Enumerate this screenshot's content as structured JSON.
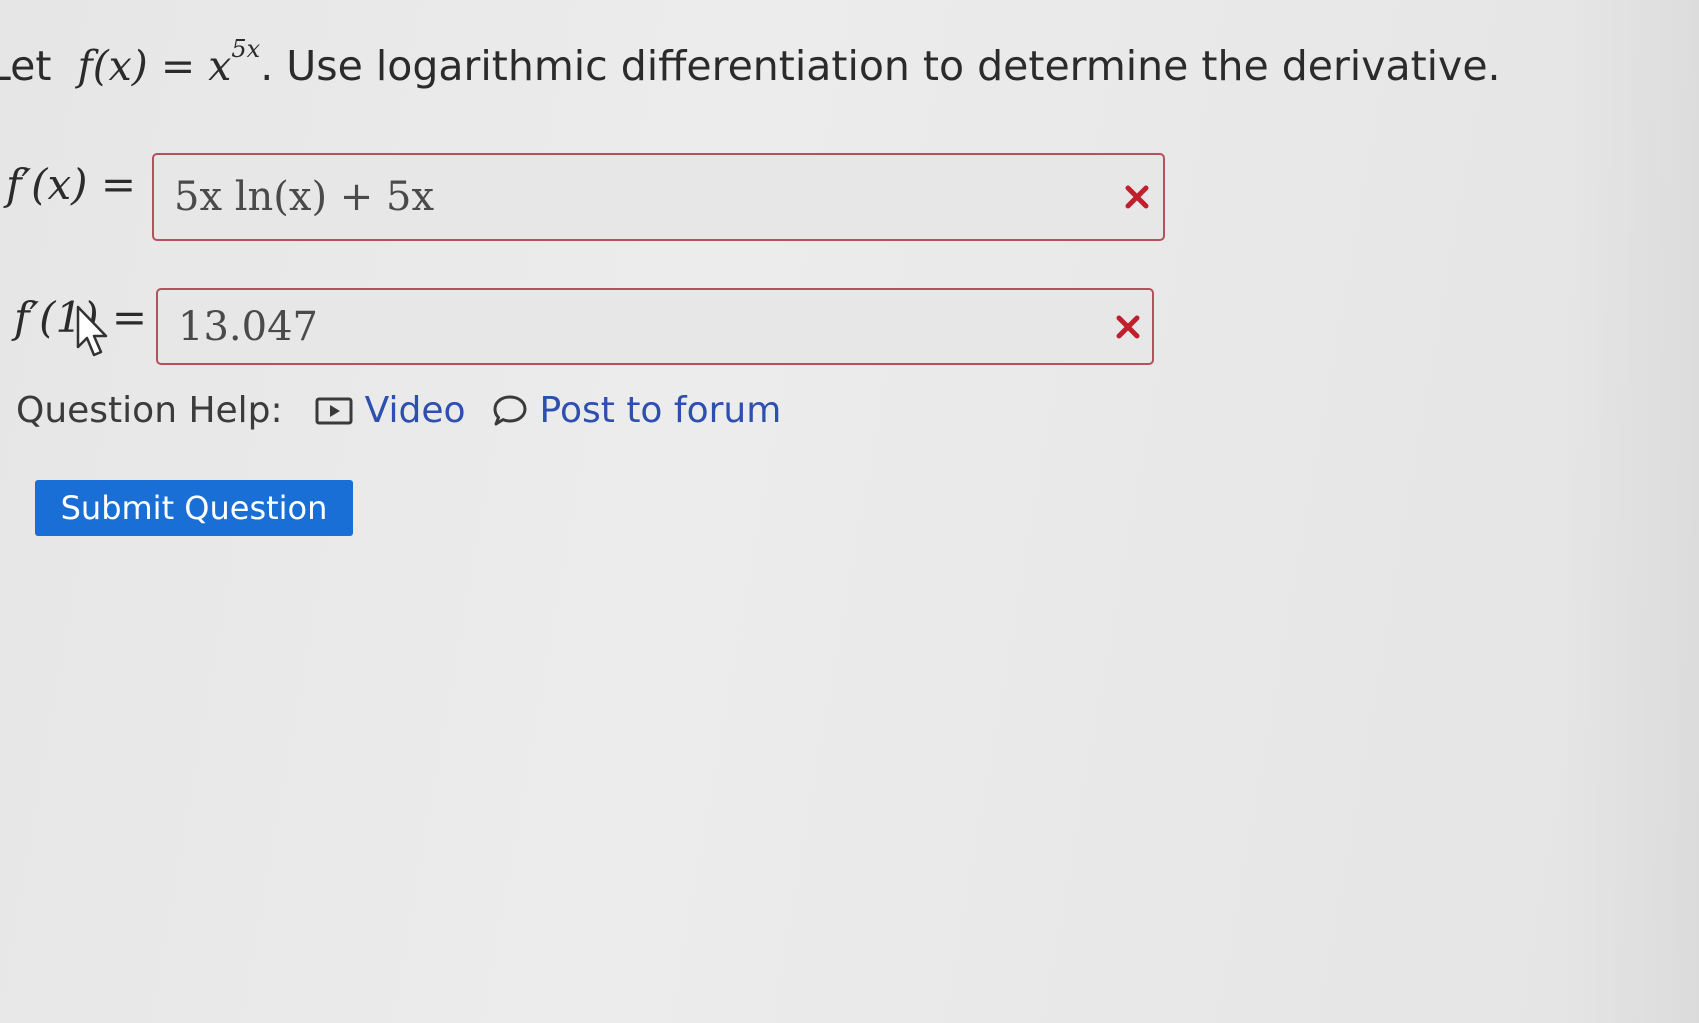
{
  "question": {
    "prefix": "Let",
    "function_lhs": "f(x) =",
    "base": "x",
    "exponent": "5x",
    "rest": ". Use logarithmic differentiation to determine the derivative."
  },
  "answers": [
    {
      "label": "f′(x) =",
      "value": "5x ln(x) + 5x",
      "status": "incorrect",
      "status_icon": "x-mark-icon"
    },
    {
      "label": "f′(1) =",
      "value": "13.047",
      "status": "incorrect",
      "status_icon": "x-mark-icon"
    }
  ],
  "help": {
    "label": "Question Help:",
    "video_label": "Video",
    "forum_label": "Post to forum"
  },
  "submit_label": "Submit Question",
  "colors": {
    "error_border": "#b5505c",
    "error_icon": "#c0202d",
    "link": "#2d4fb0",
    "button": "#1a6fd6"
  }
}
